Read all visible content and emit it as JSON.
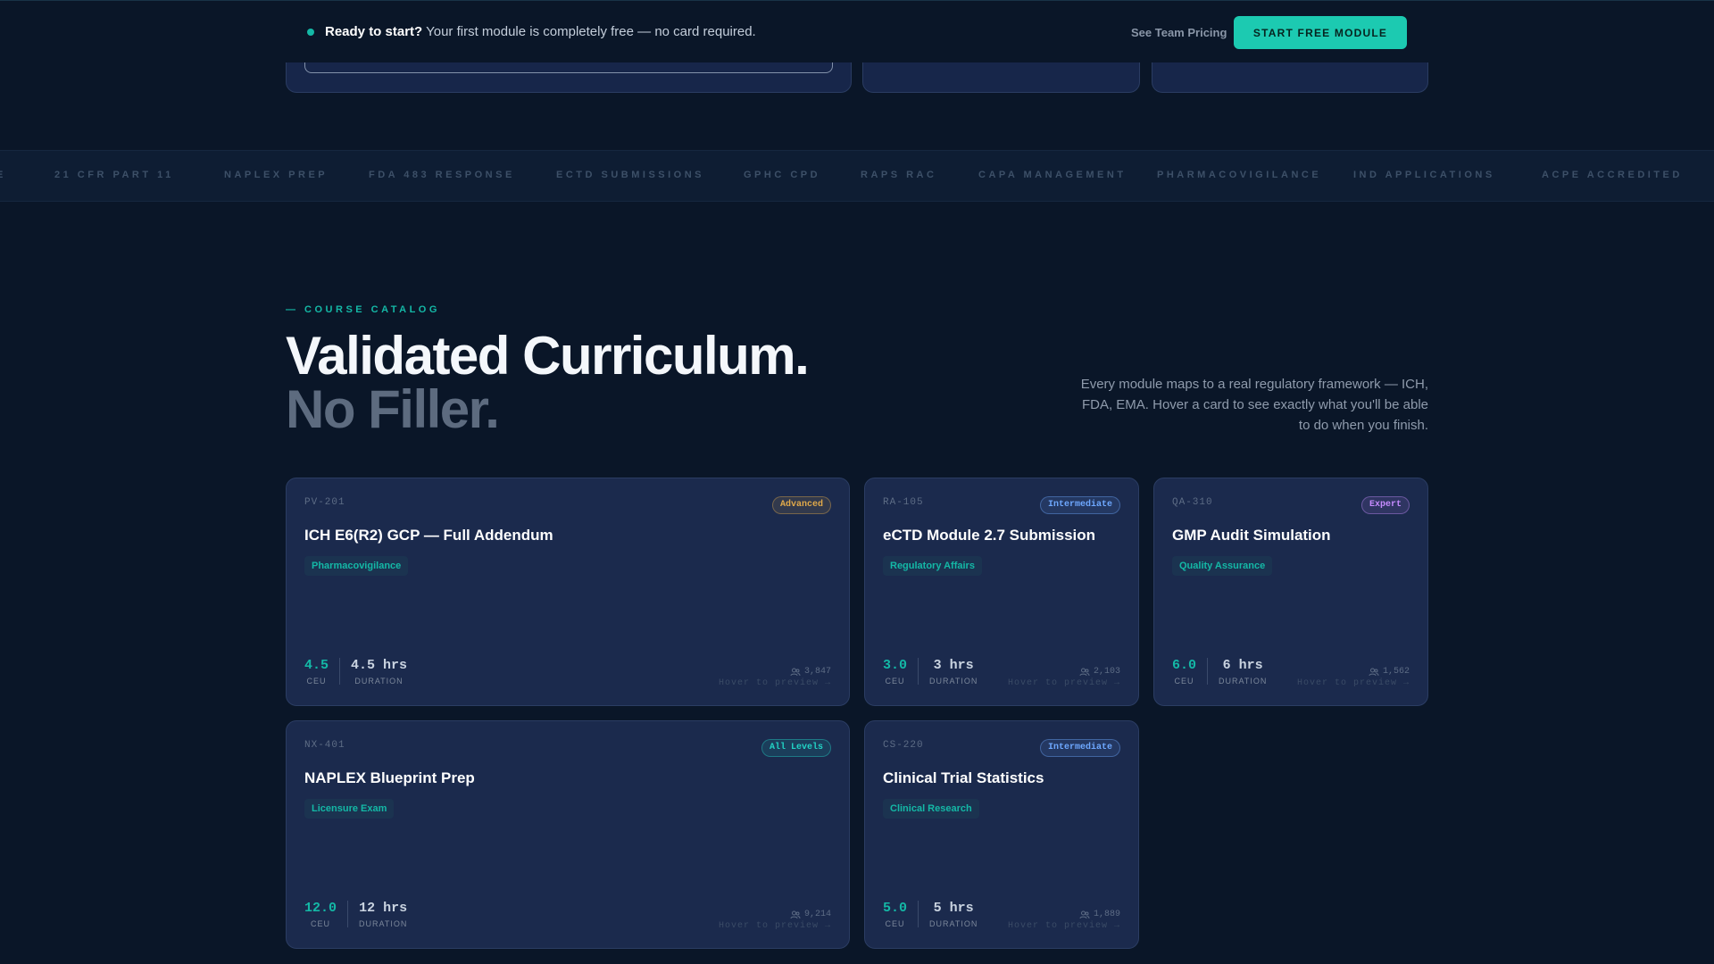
{
  "banner": {
    "lead": "Ready to start?",
    "text": " Your first module is completely free — no card required.",
    "team_link": "See Team Pricing",
    "cta": "START FREE MODULE"
  },
  "marquee": [
    "E",
    "21 CFR PART 11",
    "NAPLEX PREP",
    "FDA 483 RESPONSE",
    "ECTD SUBMISSIONS",
    "GPHC CPD",
    "RAPS RAC",
    "CAPA MANAGEMENT",
    "PHARMACOVIGILANCE",
    "IND APPLICATIONS",
    "ACPE ACCREDITED"
  ],
  "catalog": {
    "eyebrow": "— COURSE CATALOG",
    "title_line1": "Validated Curriculum.",
    "title_line2": "No Filler.",
    "intro": "Every module maps to a real regulatory framework — ICH, FDA, EMA. Hover a card to see exactly what you'll be able to do when you finish."
  },
  "labels": {
    "ceu": "CEU",
    "duration": "DURATION",
    "hover": "Hover to preview →"
  },
  "colors": {
    "accent": "#14b8a6",
    "advanced": "#e0a94a",
    "intermediate": "#6ea8ff",
    "expert": "#c58bff",
    "all_levels": "#22d3c5"
  },
  "courses": [
    {
      "code": "PV-201",
      "level": "Advanced",
      "title": "ICH E6(R2) GCP — Full Addendum",
      "tag": "Pharmacovigilance",
      "ceu": "4.5",
      "duration": "4.5 hrs",
      "enrolled": "3,847"
    },
    {
      "code": "RA-105",
      "level": "Intermediate",
      "title": "eCTD Module 2.7 Submission",
      "tag": "Regulatory Affairs",
      "ceu": "3.0",
      "duration": "3 hrs",
      "enrolled": "2,103"
    },
    {
      "code": "QA-310",
      "level": "Expert",
      "title": "GMP Audit Simulation",
      "tag": "Quality Assurance",
      "ceu": "6.0",
      "duration": "6 hrs",
      "enrolled": "1,562"
    },
    {
      "code": "NX-401",
      "level": "All Levels",
      "title": "NAPLEX Blueprint Prep",
      "tag": "Licensure Exam",
      "ceu": "12.0",
      "duration": "12 hrs",
      "enrolled": "9,214"
    },
    {
      "code": "CS-220",
      "level": "Intermediate",
      "title": "Clinical Trial Statistics",
      "tag": "Clinical Research",
      "ceu": "5.0",
      "duration": "5 hrs",
      "enrolled": "1,889"
    }
  ]
}
